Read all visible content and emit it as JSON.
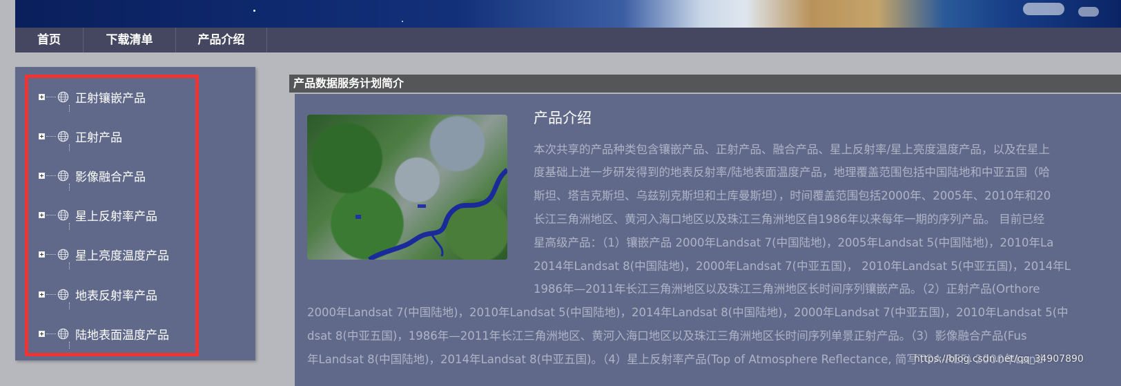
{
  "nav": {
    "items": [
      "首页",
      "下载清单",
      "产品介绍"
    ]
  },
  "tree": {
    "items": [
      {
        "label": "正射镶嵌产品"
      },
      {
        "label": "正射产品"
      },
      {
        "label": "影像融合产品"
      },
      {
        "label": "星上反射率产品"
      },
      {
        "label": "星上亮度温度产品"
      },
      {
        "label": "地表反射率产品"
      },
      {
        "label": "陆地表面温度产品"
      }
    ]
  },
  "content": {
    "header": "产品数据服务计划简介",
    "title": "产品介绍",
    "lines": [
      "本次共享的产品种类包含镶嵌产品、正射产品、融合产品、星上反射率/星上亮度温度产品，以及在星上",
      "度基础上进一步研发得到的地表反射率/陆地表面温度产品，地理覆盖范围包括中国陆地和中亚五国（哈",
      "斯坦、塔吉克斯坦、乌兹别克斯坦和土库曼斯坦），时间覆盖范围包括2000年、2005年、2010年和20",
      "长江三角洲地区、黄河入海口地区以及珠江三角洲地区自1986年以来每年一期的序列产品。 目前已经",
      "星高级产品：（1）镶嵌产品 2000年Landsat 7(中国陆地)，2005年Landsat 5(中国陆地)，2010年La",
      "2014年Landsat 8(中国陆地)，2000年Landsat 7(中亚五国)， 2010年Landsat 5(中亚五国)，2014年L",
      "1986年—2011年长江三角洲地区以及珠江三角洲地区长时间序列镶嵌产品。（2）正射产品(Orthore",
      "2000年Landsat 7(中国陆地)，2010年Landsat 5(中国陆地)，2014年Landsat 8(中国陆地)，2000年Landsat 7(中亚五国)，2010年Landsat 5(中",
      "dsat 8(中亚五国)，1986年—2011年长江三角洲地区、黄河入海口地区以及珠江三角洲地区长时间序列单景正射产品。（3）影像融合产品(Fus",
      "年Landsat 8(中国陆地)，2014年Landsat 8(中亚五国)。（4）星上反射率产品(Top of Atmosphere Reflectance, 简写TOA-REF) 2000年Land"
    ],
    "watermark": "https://blog.csdn.net/qq_34907890"
  },
  "colors": {
    "nav_bg": "#44475f",
    "panel_bg": "#60698a",
    "highlight": "#ee3535",
    "header_bg": "#555657"
  }
}
